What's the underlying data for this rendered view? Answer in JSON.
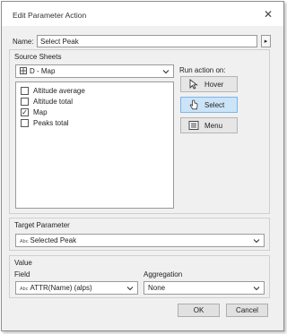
{
  "dialog": {
    "title": "Edit Parameter Action",
    "close_glyph": "✕"
  },
  "name": {
    "label": "Name:",
    "value": "Select Peak",
    "expand_glyph": "▸"
  },
  "source_sheets": {
    "label": "Source Sheets",
    "selected_sheet": "D - Map",
    "items": [
      {
        "label": "Altitude average",
        "checked": false
      },
      {
        "label": "Altitude total",
        "checked": false
      },
      {
        "label": "Map",
        "checked": true
      },
      {
        "label": "Peaks total",
        "checked": false
      }
    ]
  },
  "run_action": {
    "label": "Run action on:",
    "hover": "Hover",
    "select": "Select",
    "menu": "Menu",
    "selected": "Select"
  },
  "target_parameter": {
    "label": "Target Parameter",
    "type_badge": "Abc",
    "value": "Selected Peak"
  },
  "value_section": {
    "label": "Value",
    "field_label": "Field",
    "field_badge": "Abc",
    "field_value": "ATTR(Name) (alps)",
    "aggregation_label": "Aggregation",
    "aggregation_value": "None"
  },
  "buttons": {
    "ok": "OK",
    "cancel": "Cancel"
  },
  "check_glyph": "✓",
  "colors": {
    "selected_button": "#cce4f7",
    "selected_border": "#7eb4ea",
    "dialog_bg": "#f0f0f0"
  }
}
